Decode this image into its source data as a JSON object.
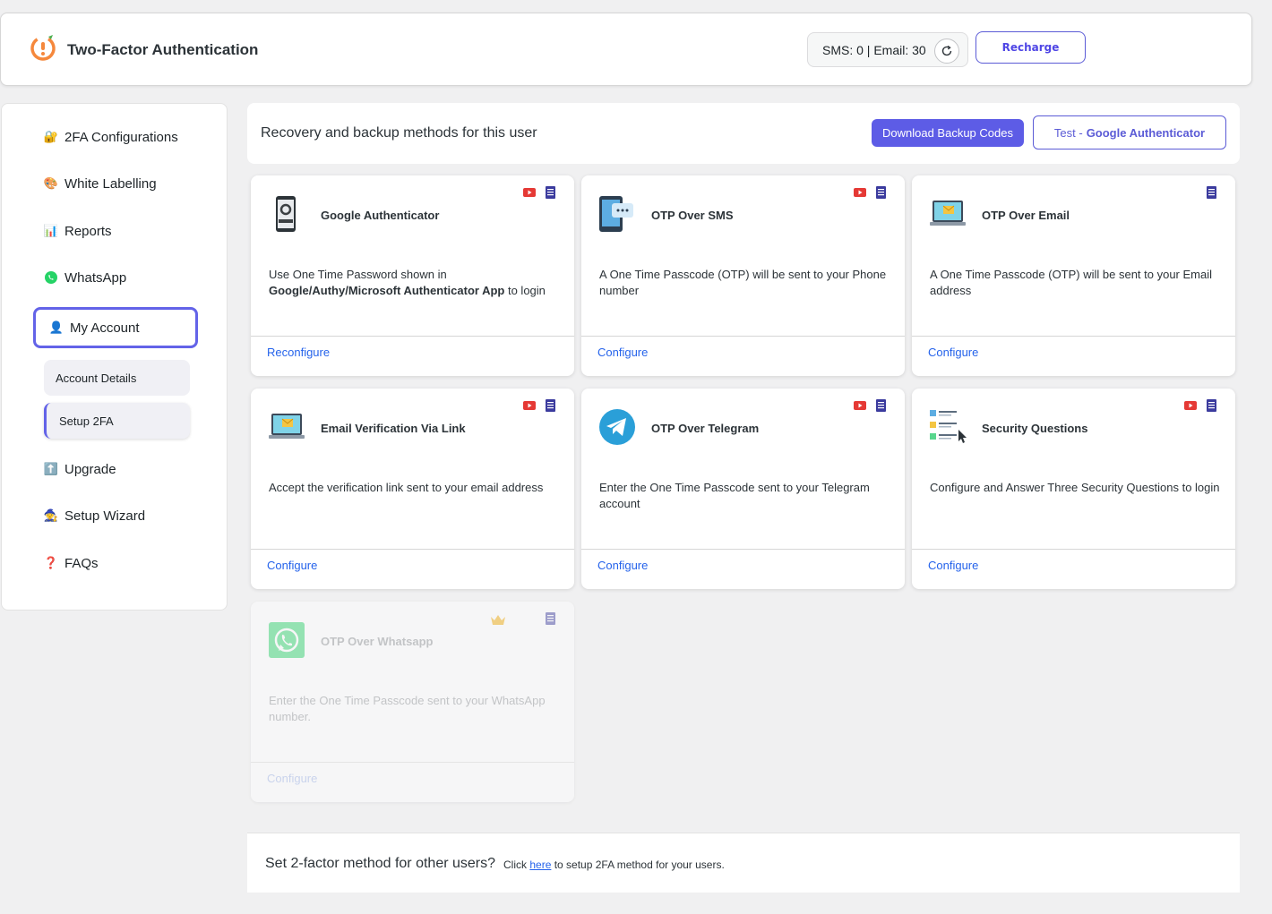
{
  "header": {
    "title": "Two-Factor Authentication",
    "counter": "SMS: 0 | Email: 30",
    "recharge_label": "Recharge"
  },
  "sidebar": {
    "items": [
      {
        "emoji": "🔐",
        "label": "2FA Configurations"
      },
      {
        "emoji": "🎨",
        "label": "White Labelling"
      },
      {
        "emoji": "📊",
        "label": "Reports"
      },
      {
        "emoji": "whatsapp-icon",
        "label": "WhatsApp"
      },
      {
        "emoji": "👤",
        "label": "My Account"
      },
      {
        "emoji": "⬆️",
        "label": "Upgrade"
      },
      {
        "emoji": "🧙",
        "label": "Setup Wizard"
      },
      {
        "emoji": "❓",
        "label": "FAQs"
      }
    ],
    "sub_items": [
      "Account Details",
      "Setup 2FA"
    ]
  },
  "main": {
    "title": "Recovery and backup methods for this user",
    "download_label": "Download Backup Codes",
    "test_prefix": "Test - ",
    "test_method": "Google Authenticator"
  },
  "methods": [
    {
      "title": "Google Authenticator",
      "desc_pre": "Use One Time Password shown in ",
      "desc_bold": "Google/Authy/Microsoft Authenticator App",
      "desc_post": " to login",
      "link": "Reconfigure"
    },
    {
      "title": "OTP Over SMS",
      "desc": "A One Time Passcode (OTP) will be sent to your Phone number",
      "link": "Configure"
    },
    {
      "title": "OTP Over Email",
      "desc": "A One Time Passcode (OTP) will be sent to your Email address",
      "link": "Configure"
    },
    {
      "title": "Email Verification Via Link",
      "desc": "Accept the verification link sent to your email address",
      "link": "Configure"
    },
    {
      "title": "OTP Over Telegram",
      "desc": "Enter the One Time Passcode sent to your Telegram account",
      "link": "Configure"
    },
    {
      "title": "Security Questions",
      "desc": "Configure and Answer Three Security Questions to login",
      "link": "Configure"
    },
    {
      "title": "OTP Over Whatsapp",
      "desc": "Enter the One Time Passcode sent to your WhatsApp number.",
      "link": "Configure"
    }
  ],
  "footer": {
    "question": "Set 2-factor method for other users?",
    "text_pre": "Click ",
    "link": "here",
    "text_post": " to setup 2FA method for your users."
  },
  "colors": {
    "accent": "#5d5ce6",
    "link": "#2563eb",
    "youtube": "#e53935",
    "doc": "#3b3b9e"
  }
}
